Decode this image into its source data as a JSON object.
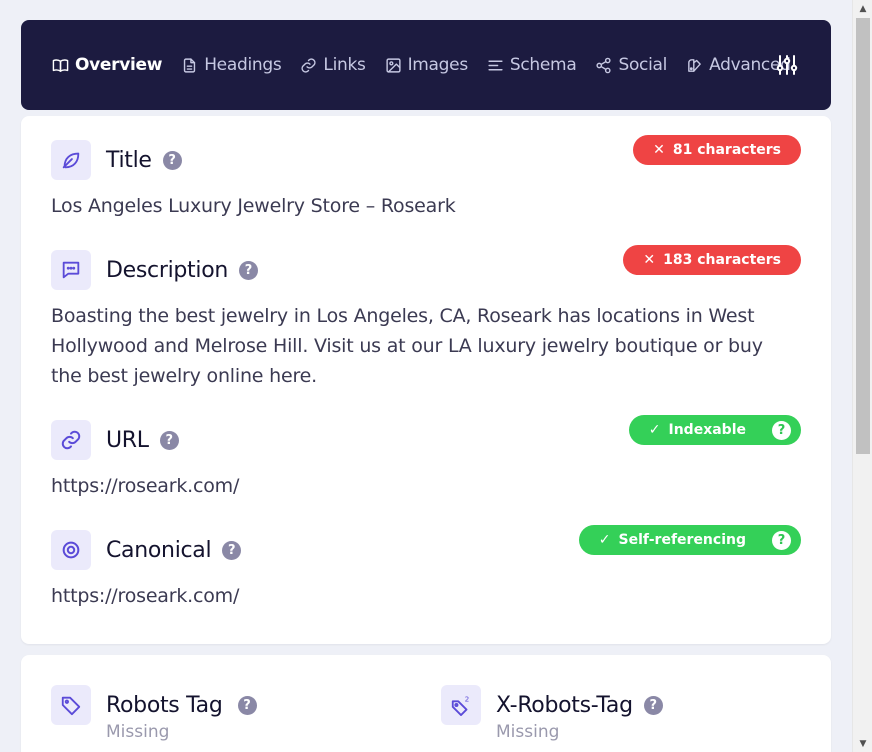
{
  "nav": {
    "items": [
      {
        "label": "Overview",
        "icon": "book-icon",
        "active": true
      },
      {
        "label": "Headings",
        "icon": "document-icon"
      },
      {
        "label": "Links",
        "icon": "link-icon"
      },
      {
        "label": "Images",
        "icon": "image-icon"
      },
      {
        "label": "Schema",
        "icon": "list-icon"
      },
      {
        "label": "Social",
        "icon": "share-icon"
      },
      {
        "label": "Advanced",
        "icon": "advanced-icon"
      }
    ],
    "settings_icon": "sliders-icon"
  },
  "overview": {
    "title": {
      "label": "Title",
      "badge": "81 characters",
      "value": "Los Angeles Luxury Jewelry Store – Roseark"
    },
    "description": {
      "label": "Description",
      "badge": "183 characters",
      "value": "Boasting the best jewelry in Los Angeles, CA, Roseark has locations in West Hollywood and Melrose Hill. Visit us at our LA luxury jewelry boutique or buy the best jewelry online here."
    },
    "url": {
      "label": "URL",
      "badge": "Indexable",
      "value": "https://roseark.com/"
    },
    "canonical": {
      "label": "Canonical",
      "badge": "Self-referencing",
      "value": "https://roseark.com/"
    }
  },
  "robots": {
    "robots_tag": {
      "label": "Robots Tag",
      "value": "Missing"
    },
    "x_robots_tag": {
      "label": "X-Robots-Tag",
      "value": "Missing"
    }
  },
  "colors": {
    "nav_bg": "#1c1b40",
    "accent": "#5b4bd8",
    "error": "#ef4444",
    "success": "#34d058"
  }
}
